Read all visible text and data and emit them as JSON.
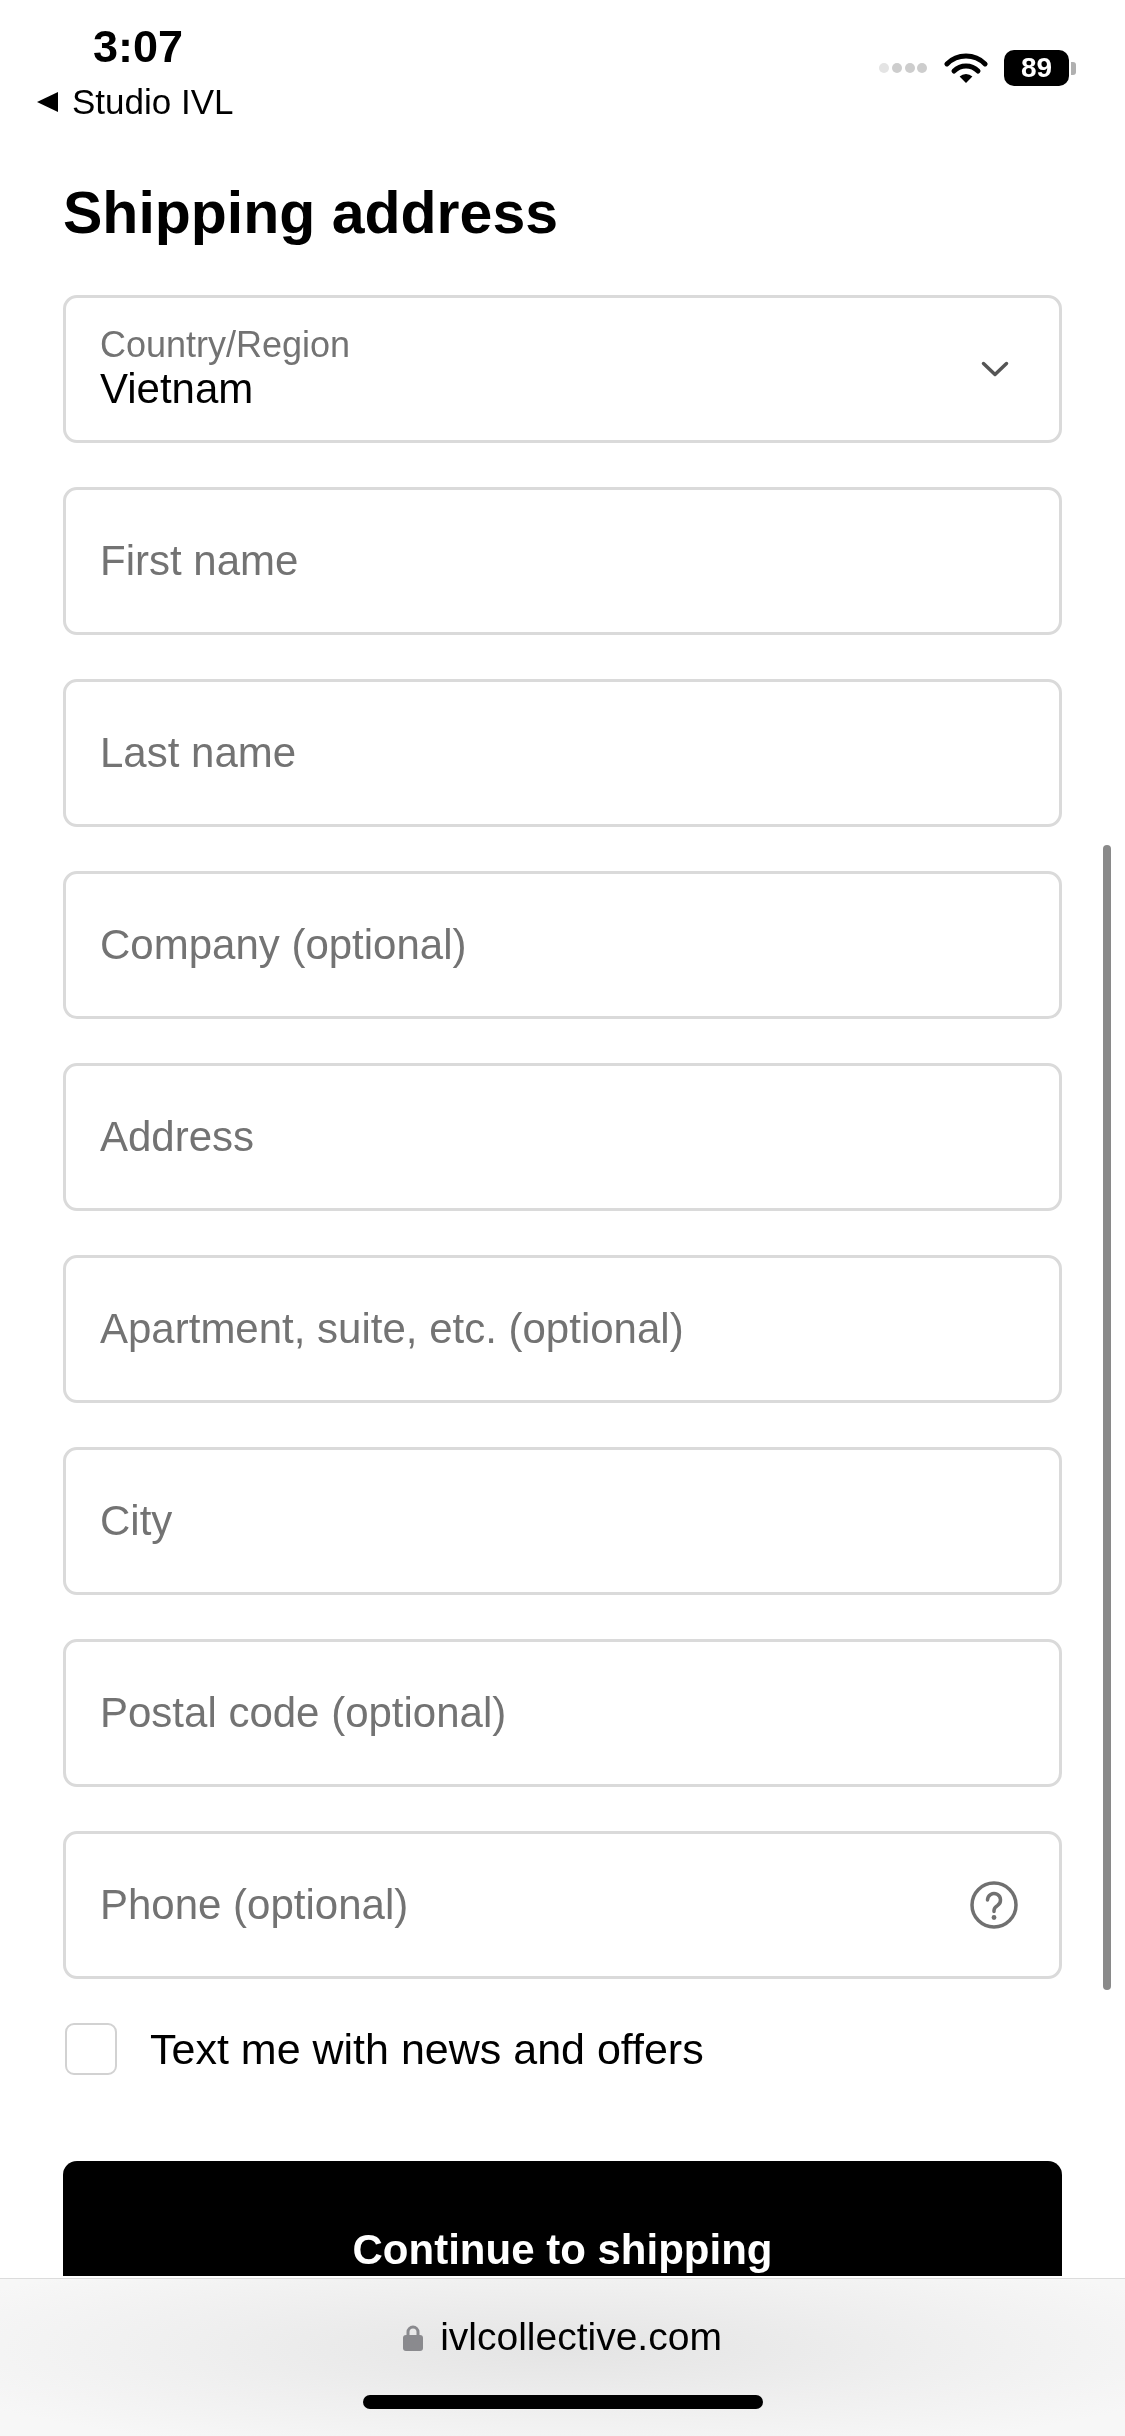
{
  "status_bar": {
    "time": "3:07",
    "back_label": "Studio IVL",
    "battery": "89"
  },
  "heading": "Shipping address",
  "fields": [
    {
      "kind": "select",
      "label": "Country/Region",
      "value": "Vietnam",
      "help": false
    },
    {
      "kind": "text",
      "placeholder": "First name",
      "help": false
    },
    {
      "kind": "text",
      "placeholder": "Last name",
      "help": false
    },
    {
      "kind": "text",
      "placeholder": "Company (optional)",
      "help": false
    },
    {
      "kind": "text",
      "placeholder": "Address",
      "help": false
    },
    {
      "kind": "text",
      "placeholder": "Apartment, suite, etc. (optional)",
      "help": false
    },
    {
      "kind": "text",
      "placeholder": "City",
      "help": false
    },
    {
      "kind": "text",
      "placeholder": "Postal code (optional)",
      "help": false
    },
    {
      "kind": "text",
      "placeholder": "Phone (optional)",
      "help": true
    }
  ],
  "newsletter": {
    "label": "Text me with news and offers",
    "checked": false
  },
  "submit": {
    "label": "Continue to shipping"
  },
  "browser": {
    "url": "ivlcollective.com",
    "secure": true
  }
}
